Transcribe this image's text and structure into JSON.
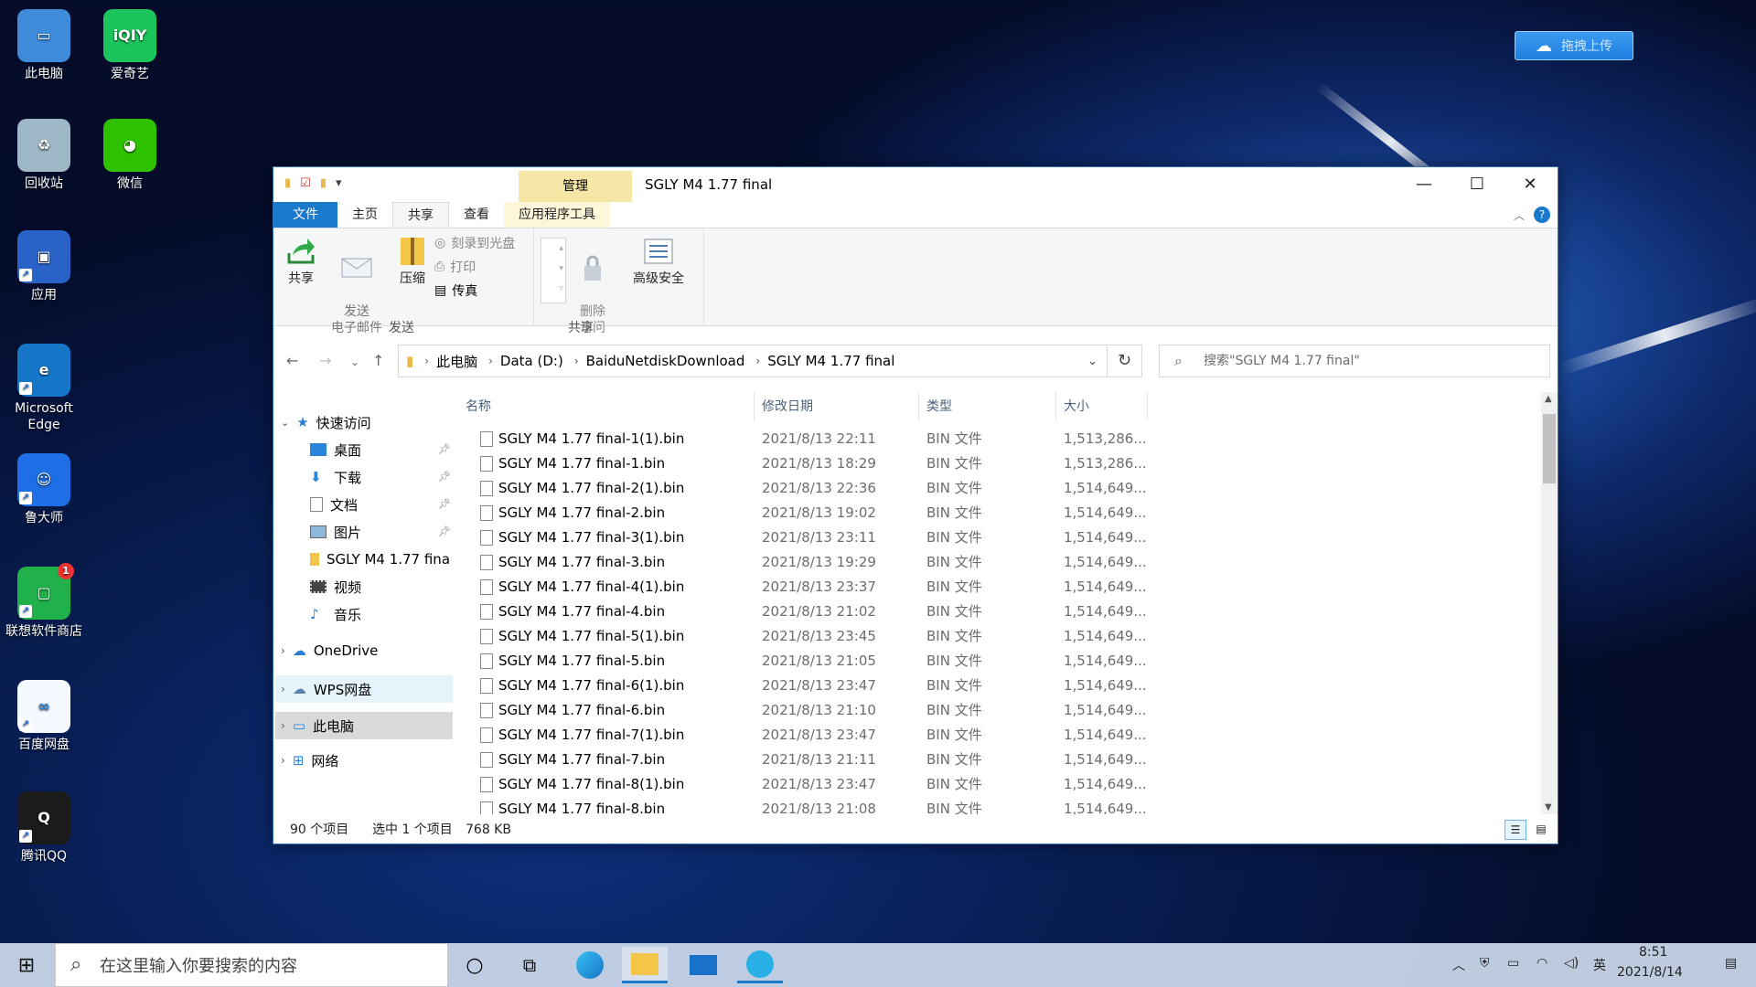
{
  "desktop": {
    "icons": [
      {
        "label": "此电脑",
        "color": "#3d8bd9",
        "glyph": "▭"
      },
      {
        "label": "爱奇艺",
        "color": "#1cc55c",
        "glyph": "iQIY"
      },
      {
        "label": "回收站",
        "color": "#9fb8c8",
        "glyph": "♻"
      },
      {
        "label": "微信",
        "color": "#2dc100",
        "glyph": "◕"
      },
      {
        "label": "应用",
        "color": "#2a63c8",
        "glyph": "▣"
      },
      {
        "label": "Microsoft Edge",
        "color": "#1677c9",
        "glyph": "e"
      },
      {
        "label": "鲁大师",
        "color": "#1e6ee6",
        "glyph": "☺"
      },
      {
        "label": "联想软件商店",
        "color": "#21b14b",
        "glyph": "▢",
        "badge": "1"
      },
      {
        "label": "百度网盘",
        "color": "#f4f8ff",
        "glyph": "∞"
      },
      {
        "label": "腾讯QQ",
        "color": "#1b1b1b",
        "glyph": "Q"
      }
    ],
    "upload_label": "拖拽上传"
  },
  "window": {
    "context_tab": "管理",
    "title": "SGLY M4 1.77 final",
    "tabs": [
      "文件",
      "主页",
      "共享",
      "查看",
      "应用程序工具"
    ],
    "ribbon": {
      "share": "共享",
      "email": "发送\n电子邮件",
      "zip": "压缩",
      "burn": "刻录到光盘",
      "print": "打印",
      "fax": "传真",
      "group_send": "发送",
      "remove_access": "删除\n访问",
      "advanced_security": "高级安全",
      "group_share": "共享"
    },
    "address": {
      "crumbs": [
        "此电脑",
        "Data (D:)",
        "BaiduNetdiskDownload",
        "SGLY M4 1.77 final"
      ],
      "search_placeholder": "搜索\"SGLY M4 1.77 final\""
    },
    "nav": {
      "quick_access": "快速访问",
      "items": [
        "桌面",
        "下载",
        "文档",
        "图片",
        "SGLY M4 1.77 fina",
        "视频",
        "音乐"
      ],
      "onedrive": "OneDrive",
      "wps": "WPS网盘",
      "thispc": "此电脑",
      "network": "网络"
    },
    "columns": [
      "名称",
      "修改日期",
      "类型",
      "大小"
    ],
    "files": [
      {
        "name": "SGLY M4 1.77 final-1(1).bin",
        "date": "2021/8/13 22:11",
        "type": "BIN 文件",
        "size": "1,513,286..."
      },
      {
        "name": "SGLY M4 1.77 final-1.bin",
        "date": "2021/8/13 18:29",
        "type": "BIN 文件",
        "size": "1,513,286..."
      },
      {
        "name": "SGLY M4 1.77 final-2(1).bin",
        "date": "2021/8/13 22:36",
        "type": "BIN 文件",
        "size": "1,514,649..."
      },
      {
        "name": "SGLY M4 1.77 final-2.bin",
        "date": "2021/8/13 19:02",
        "type": "BIN 文件",
        "size": "1,514,649..."
      },
      {
        "name": "SGLY M4 1.77 final-3(1).bin",
        "date": "2021/8/13 23:11",
        "type": "BIN 文件",
        "size": "1,514,649..."
      },
      {
        "name": "SGLY M4 1.77 final-3.bin",
        "date": "2021/8/13 19:29",
        "type": "BIN 文件",
        "size": "1,514,649..."
      },
      {
        "name": "SGLY M4 1.77 final-4(1).bin",
        "date": "2021/8/13 23:37",
        "type": "BIN 文件",
        "size": "1,514,649..."
      },
      {
        "name": "SGLY M4 1.77 final-4.bin",
        "date": "2021/8/13 21:02",
        "type": "BIN 文件",
        "size": "1,514,649..."
      },
      {
        "name": "SGLY M4 1.77 final-5(1).bin",
        "date": "2021/8/13 23:45",
        "type": "BIN 文件",
        "size": "1,514,649..."
      },
      {
        "name": "SGLY M4 1.77 final-5.bin",
        "date": "2021/8/13 21:05",
        "type": "BIN 文件",
        "size": "1,514,649..."
      },
      {
        "name": "SGLY M4 1.77 final-6(1).bin",
        "date": "2021/8/13 23:47",
        "type": "BIN 文件",
        "size": "1,514,649..."
      },
      {
        "name": "SGLY M4 1.77 final-6.bin",
        "date": "2021/8/13 21:10",
        "type": "BIN 文件",
        "size": "1,514,649..."
      },
      {
        "name": "SGLY M4 1.77 final-7(1).bin",
        "date": "2021/8/13 23:47",
        "type": "BIN 文件",
        "size": "1,514,649..."
      },
      {
        "name": "SGLY M4 1.77 final-7.bin",
        "date": "2021/8/13 21:11",
        "type": "BIN 文件",
        "size": "1,514,649..."
      },
      {
        "name": "SGLY M4 1.77 final-8(1).bin",
        "date": "2021/8/13 23:47",
        "type": "BIN 文件",
        "size": "1,514,649..."
      },
      {
        "name": "SGLY M4 1.77 final-8.bin",
        "date": "2021/8/13 21:08",
        "type": "BIN 文件",
        "size": "1,514,649..."
      }
    ],
    "status": {
      "count": "90 个项目",
      "selected": "选中 1 个项目",
      "size": "768 KB"
    }
  },
  "taskbar": {
    "search_placeholder": "在这里输入你要搜索的内容",
    "ime": "英",
    "time": "8:51",
    "date": "2021/8/14"
  },
  "colors": {
    "accent": "#1979ca",
    "manage": "#f6e7a6"
  }
}
